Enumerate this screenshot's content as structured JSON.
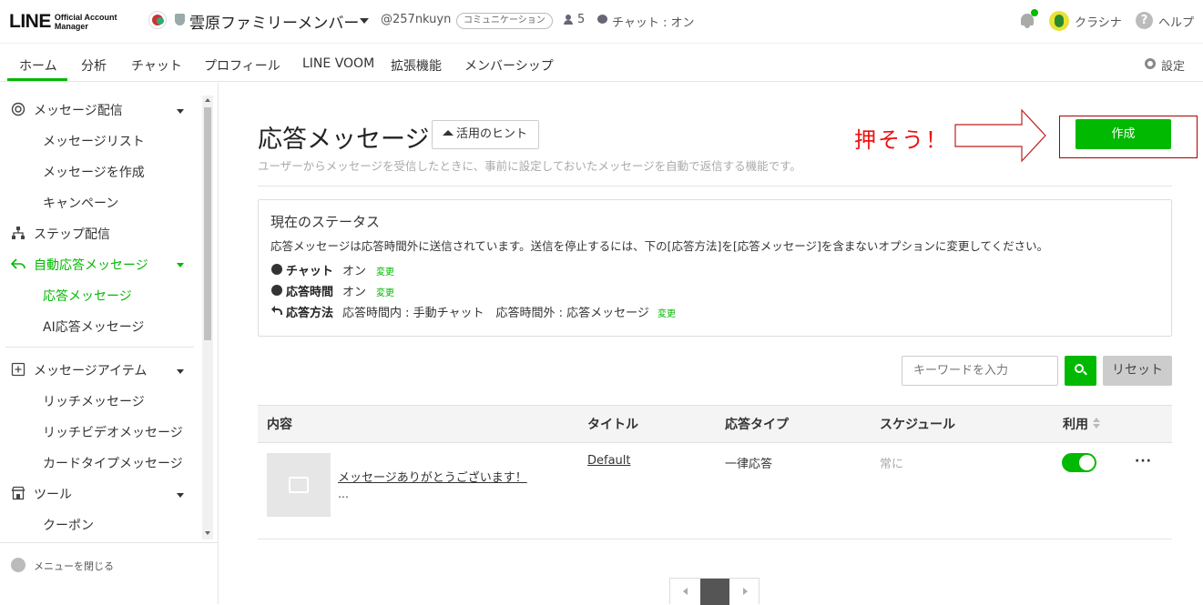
{
  "header": {
    "logo_main": "LINE",
    "logo_sub_1": "Official Account",
    "logo_sub_2": "Manager",
    "account_name": "雲原ファミリーメンバー",
    "account_id": "@257nkuyn",
    "plan_badge": "コミュニケーション",
    "friends_count": "5",
    "chat_status": "チャット : オン",
    "user_name": "クラシナ",
    "help_label": "ヘルプ"
  },
  "nav": {
    "items": [
      "ホーム",
      "分析",
      "チャット",
      "プロフィール",
      "LINE VOOM",
      "拡張機能",
      "メンバーシップ"
    ],
    "settings_label": "設定"
  },
  "sidebar": {
    "sections": [
      {
        "label": "メッセージ配信",
        "items": [
          "メッセージリスト",
          "メッセージを作成",
          "キャンペーン"
        ]
      },
      {
        "label": "ステップ配信",
        "items": []
      },
      {
        "label": "自動応答メッセージ",
        "items": [
          "応答メッセージ",
          "AI応答メッセージ"
        ]
      },
      {
        "label": "メッセージアイテム",
        "items": [
          "リッチメッセージ",
          "リッチビデオメッセージ",
          "カードタイプメッセージ"
        ]
      },
      {
        "label": "ツール",
        "items": [
          "クーポン"
        ]
      }
    ],
    "close_menu": "メニューを閉じる",
    "accent_color": "#00b900"
  },
  "main": {
    "title": "応答メッセージ",
    "hint_button": "活用のヒント",
    "description": "ユーザーからメッセージを受信したときに、事前に設定しておいたメッセージを自動で返信する機能です。",
    "annotation": "押そう！",
    "create_button": "作成",
    "status": {
      "title": "現在のステータス",
      "description": "応答メッセージは応答時間外に送信されています。送信を停止するには、下の[応答方法]を[応答メッセージ]を含まないオプションに変更してください。",
      "chat_label": "チャット",
      "chat_value": "オン",
      "hours_label": "応答時間",
      "hours_value": "オン",
      "method_label": "応答方法",
      "method_value": "応答時間内 : 手動チャット　応答時間外 : 応答メッセージ",
      "change_link": "変更"
    },
    "search": {
      "placeholder": "キーワードを入力",
      "reset_button": "リセット"
    },
    "table": {
      "headers": [
        "内容",
        "タイトル",
        "応答タイプ",
        "スケジュール",
        "利用"
      ],
      "rows": [
        {
          "content": "メッセージありがとうございます！",
          "ellipsis": "…",
          "title": "Default",
          "type": "一律応答",
          "schedule": "常に",
          "enabled": true,
          "more": "···"
        }
      ]
    }
  }
}
